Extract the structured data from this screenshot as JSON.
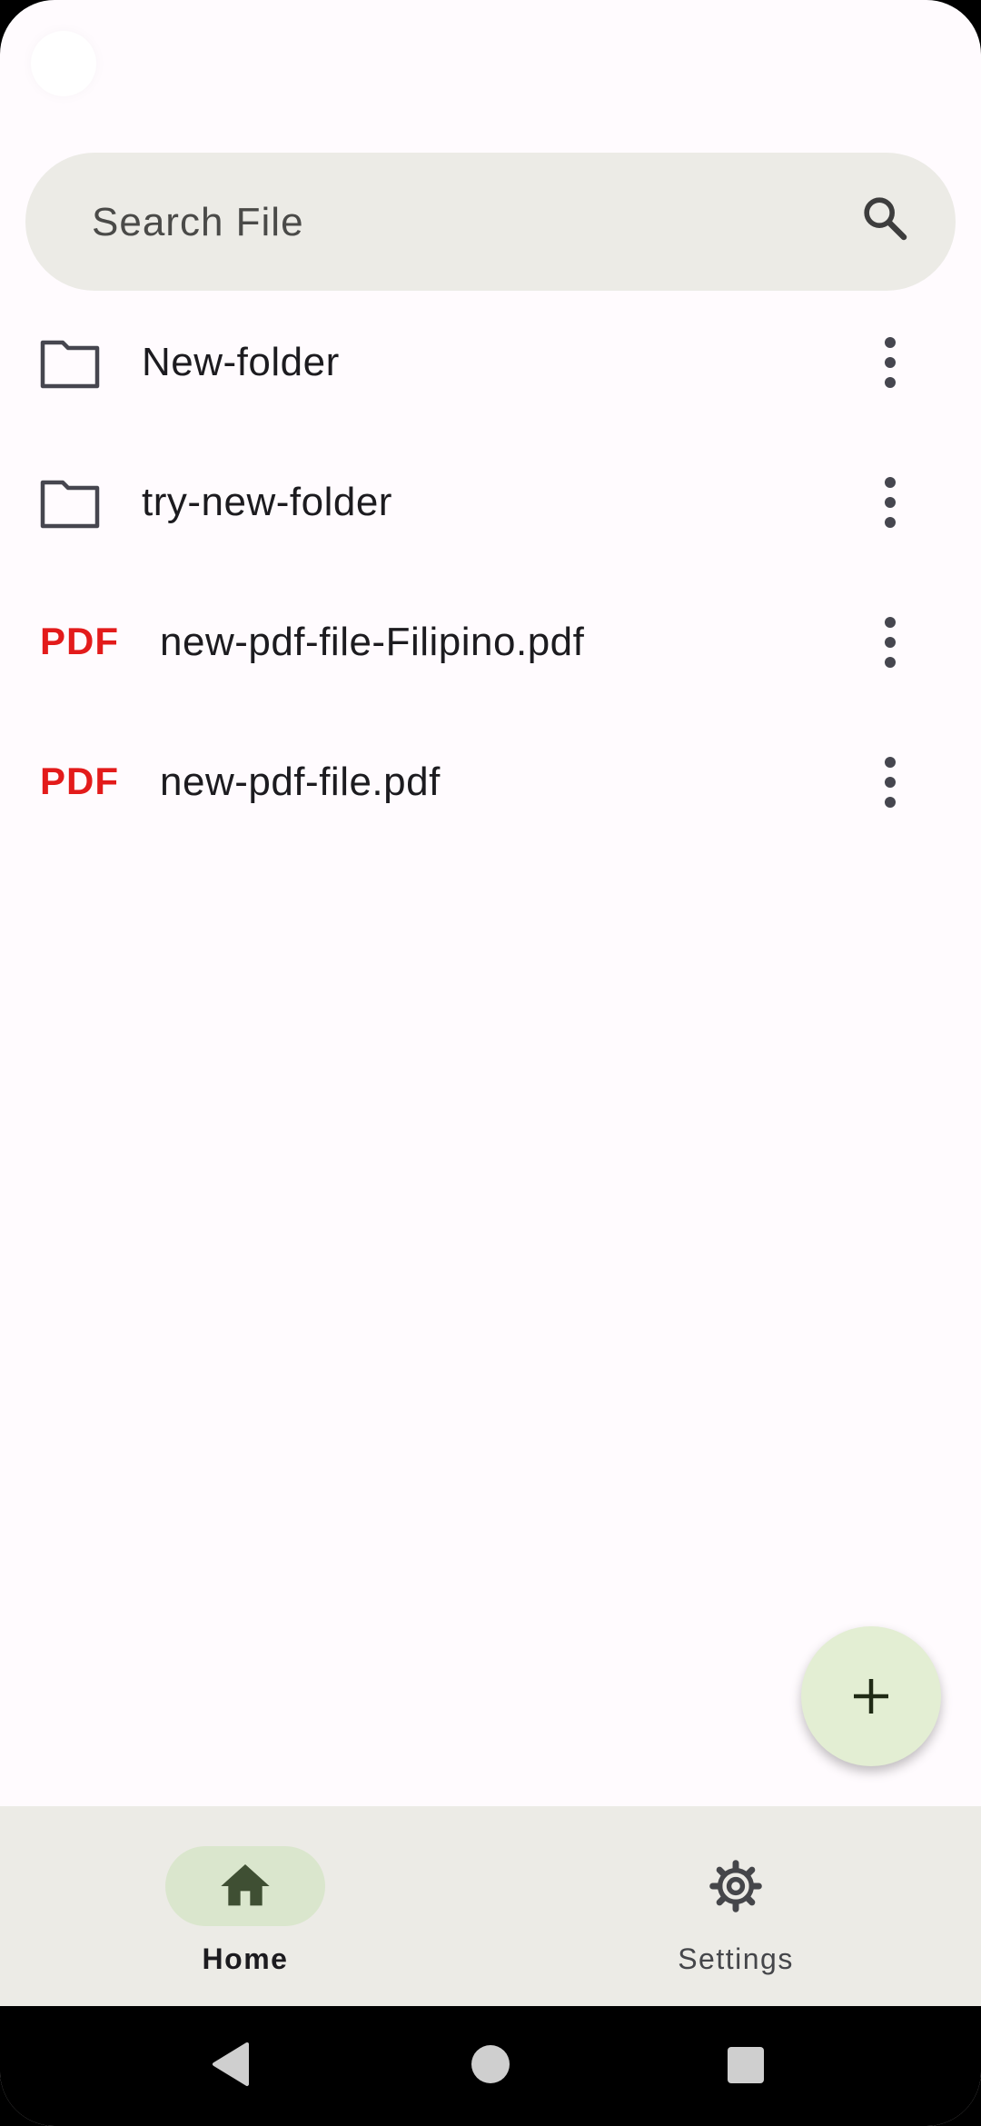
{
  "search": {
    "placeholder": "Search File"
  },
  "files": [
    {
      "type": "folder",
      "name": "New-folder"
    },
    {
      "type": "folder",
      "name": "try-new-folder"
    },
    {
      "type": "pdf",
      "badge": "PDF",
      "name": "new-pdf-file-Filipino.pdf"
    },
    {
      "type": "pdf",
      "badge": "PDF",
      "name": "new-pdf-file.pdf"
    }
  ],
  "fab": {
    "icon": "plus-icon"
  },
  "bottom_nav": {
    "items": [
      {
        "label": "Home",
        "icon": "home-icon",
        "selected": true
      },
      {
        "label": "Settings",
        "icon": "gear-icon",
        "selected": false
      }
    ]
  },
  "colors": {
    "background": "#fffbfe",
    "surface": "#ecebe6",
    "pdf_red": "#e31b1b",
    "fab": "#e3eed3",
    "nav_pill": "#dae6cd",
    "accent_dark": "#4d5f3f"
  }
}
